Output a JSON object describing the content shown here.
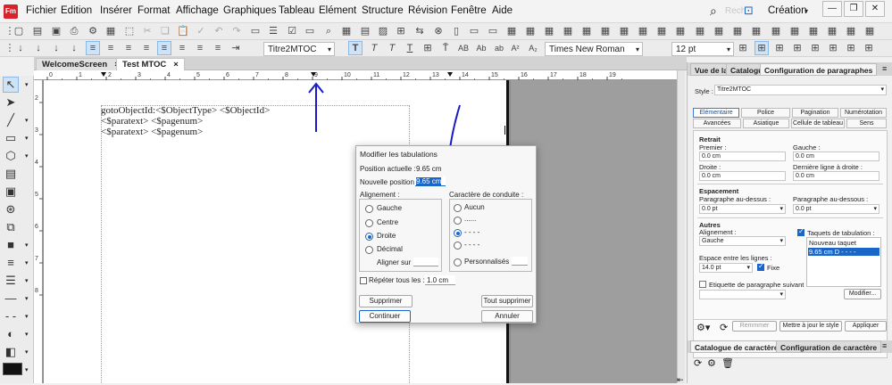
{
  "menubar": {
    "logo": "Fm",
    "items": [
      "Fichier",
      "Edition",
      "Insérer",
      "Format",
      "Affichage",
      "Graphiques",
      "Tableau",
      "Elément",
      "Structure",
      "Révision",
      "Fenêtre",
      "Aide"
    ],
    "search_hint": "Rech",
    "workspace": "Création"
  },
  "toolbar": {
    "para_format": "Titre2MTOC",
    "font_family": "Times New Roman",
    "font_size": "12 pt"
  },
  "tabs": {
    "doc1": "WelcomeScreen",
    "doc2": "Test MTOC"
  },
  "ruler": {
    "ticks": [
      "0",
      "1",
      "2",
      "3",
      "4",
      "5",
      "6",
      "7",
      "8",
      "9",
      "10",
      "11",
      "12",
      "13",
      "14",
      "15",
      "16",
      "17",
      "18",
      "19"
    ]
  },
  "document": {
    "line1": "gotoObjectId:<$ObjectType> <$ObjectId>",
    "line2": "<$paratext> <$pagenum>",
    "line3": "<$paratext> <$pagenum>",
    "vruler_ticks": [
      "2",
      "3",
      "4",
      "5",
      "6",
      "7",
      "8"
    ]
  },
  "dialog": {
    "title": "Modifier les tabulations",
    "current_position_label": "Position actuelle :",
    "current_position_value": "9.65 cm",
    "new_position_label": "Nouvelle position :",
    "new_position_value": "9.65 cm",
    "alignment_label": "Alignement :",
    "align_options": [
      "Gauche",
      "Centre",
      "Droite",
      "Décimal"
    ],
    "align_selected": "Droite",
    "align_on_label": "Aligner sur :",
    "leader_label": "Caractère de conduite :",
    "leader_options": [
      "Aucun",
      "......",
      "- - - -",
      "-  -  -  -",
      "Personnalisés :"
    ],
    "repeat_label": "Répéter tous les :",
    "repeat_value": "1.0 cm",
    "delete_label": "Supprimer",
    "delete_all_label": "Tout supprimer",
    "continue_label": "Continuer",
    "cancel_label": "Annuler"
  },
  "panel": {
    "tabs": [
      "Vue de la",
      "Catalogu",
      "Configuration de paragraphes"
    ],
    "style_label": "Style :",
    "style_value": "Titre2MTOC",
    "subtabs_row1": [
      "Elémentaire",
      "Police",
      "Pagination",
      "Numérotation"
    ],
    "subtabs_row2": [
      "Avancées",
      "Asiatique",
      "Cellule de tableau",
      "Sens"
    ],
    "retrait_label": "Retrait",
    "premier_label": "Premier :",
    "premier_value": "0.0 cm",
    "gauche_label": "Gauche :",
    "gauche_value": "0.0 cm",
    "droite_label": "Droite :",
    "droite_value": "0.0 cm",
    "derniere_label": "Dernière ligne à droite :",
    "derniere_value": "0.0 cm",
    "espacement_label": "Espacement",
    "au_dessus_label": "Paragraphe au-dessus :",
    "au_dessus_value": "0.0 pt",
    "au_dessous_label": "Paragraphe au-dessous :",
    "au_dessous_value": "0.0 pt",
    "autres_label": "Autres",
    "alignement_label": "Alignement :",
    "alignement_value": "Gauche",
    "espace_lignes_label": "Espace entre les lignes :",
    "espace_lignes_value": "14.0 pt",
    "fixe_label": "Fixe",
    "etiquette_label": "Etiquette de paragraphe suivant :",
    "taquets_label": "Taquets de tabulation :",
    "taquets_items": [
      "Nouveau taquet",
      "9.65 cm  D  - - - -"
    ],
    "modifier_label": "Modifier...",
    "remove_label": "Remmmer",
    "update_label": "Mettre à jour le style",
    "apply_label": "Appliquer",
    "bottom_tabs": [
      "Catalogue de caractères",
      "Configuration de caractère"
    ]
  },
  "colors": {
    "accent": "#1a66c8",
    "annotation_arrow": "#1a1ac8",
    "logo": "#d9232a"
  }
}
